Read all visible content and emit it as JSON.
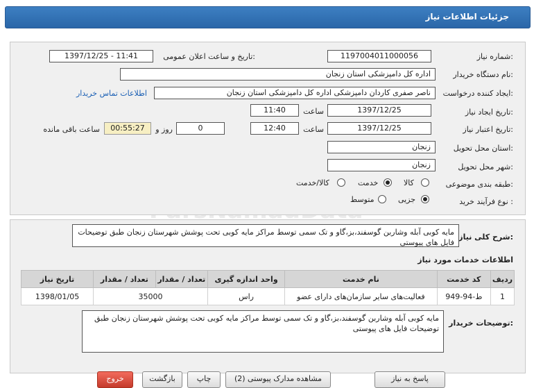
{
  "header": {
    "title": "جزئیات اطلاعات نیاز"
  },
  "form": {
    "need_number_label": "شماره نیاز:",
    "need_number": "1197004011000056",
    "announce_label": "تاریخ و ساعت اعلان عمومی:",
    "announce_value": "1397/12/25 - 11:41",
    "buyer_org_label": "نام دستگاه خریدار:",
    "buyer_org": "اداره کل دامپزشکی استان زنجان",
    "requester_label": "ایجاد کننده درخواست:",
    "requester": "ناصر صفری کاردان دامپزشکی  اداره کل دامپزشکی استان زنجان",
    "contact_link": "اطلاعات تماس خریدار",
    "created_label": "تاریخ ایجاد نیاز:",
    "created_date": "1397/12/25",
    "time_label": "ساعت",
    "created_time": "11:40",
    "valid_label": "تاریخ اعتبار نیاز:",
    "valid_date": "1397/12/25",
    "valid_time": "12:40",
    "days_label": "روز و",
    "days_value": "0",
    "remaining_value": "00:55:27",
    "remaining_label": "ساعت باقی مانده",
    "province_label": "استان محل تحویل:",
    "province": "زنجان",
    "city_label": "شهر محل تحویل:",
    "city": "زنجان",
    "category_label": "طبقه بندی موضوعی:",
    "category_options": [
      "کالا",
      "خدمت",
      "کالا/خدمت"
    ],
    "category_selected": "خدمت",
    "process_label": "نوع فرآیند خرید :",
    "process_options": [
      "جزیی",
      "متوسط"
    ],
    "process_selected": "جزیی"
  },
  "summary": {
    "label": "شرح کلی نیاز:",
    "text": "مایه کوبی آبله وشاربن گوسفند،بز،گاو و تک سمی توسط مراکز مایه کوبی تحت پوشش شهرستان زنجان طبق توضیحات فایل های پیوستی"
  },
  "services": {
    "title": "اطلاعات خدمات مورد نیاز",
    "columns": [
      "ردیف",
      "کد خدمت",
      "نام خدمت",
      "واحد اندازه گیری",
      "تعداد / مقدار",
      "تاریخ نیاز"
    ],
    "rows": [
      [
        "1",
        "ط-94-949",
        "فعالیت‌های سایر سازمان‌های دارای عضو",
        "راس",
        "35000",
        "1398/01/05"
      ]
    ]
  },
  "notes": {
    "label": "توضیحات خریدار:",
    "text": "مایه کوبی آبله وشاربن گوسفند،بز،گاو و تک سمی توسط مراکز مایه کوبی تحت پوشش شهرستان زنجان طبق توضیحات فایل های پیوستی"
  },
  "buttons": {
    "reply": "پاسخ به نیاز",
    "attachments": "مشاهده مدارک پیوستی (2)",
    "print": "چاپ",
    "back": "بازگشت",
    "exit": "خروج"
  },
  "watermark": {
    "brand": "ParsNamadData",
    "line1": "پایگاه اطلاع رسانی مناقصه و مزایده",
    "line2": "۰۲۱ - ۸۸۳۴۹۶۷۰"
  },
  "colors": {
    "header_blue": "#2f6fb3",
    "remaining_bg": "#f7efc3",
    "link": "#1a5fb4",
    "exit_red": "#d9483a"
  }
}
